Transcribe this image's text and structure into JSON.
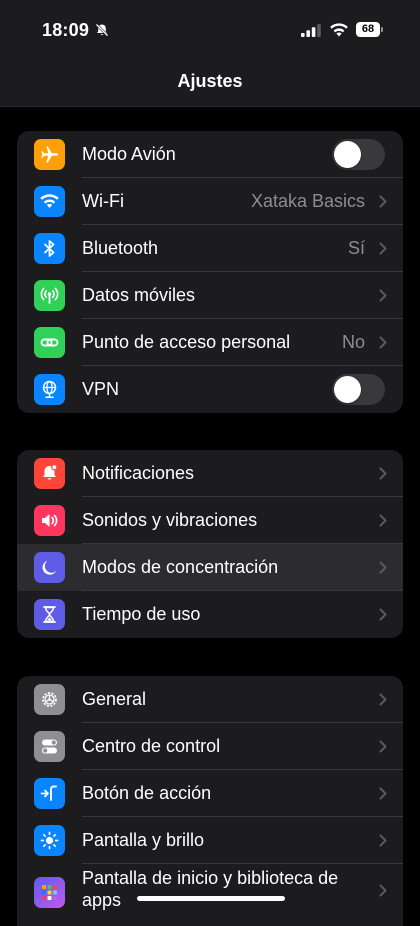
{
  "status": {
    "time": "18:09",
    "battery": "68"
  },
  "nav": {
    "title": "Ajustes"
  },
  "colors": {
    "orange": "#ff9f0a",
    "blue": "#0a84ff",
    "green": "#30d158",
    "red": "#ff453a",
    "pink": "#ff375f",
    "indigo": "#5e5ce6",
    "gray": "#8e8e93"
  },
  "groups": [
    {
      "items": [
        {
          "label": "Modo Avión",
          "icon": "airplane-icon",
          "control": "toggle",
          "on": false
        },
        {
          "label": "Wi-Fi",
          "icon": "wifi-icon",
          "value": "Xataka Basics"
        },
        {
          "label": "Bluetooth",
          "icon": "bluetooth-icon",
          "value": "Sí"
        },
        {
          "label": "Datos móviles",
          "icon": "antenna-icon"
        },
        {
          "label": "Punto de acceso personal",
          "icon": "link-icon",
          "value": "No"
        },
        {
          "label": "VPN",
          "icon": "globe-icon",
          "control": "toggle",
          "on": false
        }
      ]
    },
    {
      "items": [
        {
          "label": "Notificaciones",
          "icon": "bell-icon"
        },
        {
          "label": "Sonidos y vibraciones",
          "icon": "speaker-icon"
        },
        {
          "label": "Modos de concentración",
          "icon": "moon-icon"
        },
        {
          "label": "Tiempo de uso",
          "icon": "hourglass-icon"
        }
      ]
    },
    {
      "items": [
        {
          "label": "General",
          "icon": "gear-icon"
        },
        {
          "label": "Centro de control",
          "icon": "switches-icon"
        },
        {
          "label": "Botón de acción",
          "icon": "action-button-icon"
        },
        {
          "label": "Pantalla y brillo",
          "icon": "sun-icon"
        },
        {
          "label": "Pantalla de inicio y biblioteca de apps",
          "icon": "app-grid-icon"
        }
      ]
    }
  ]
}
